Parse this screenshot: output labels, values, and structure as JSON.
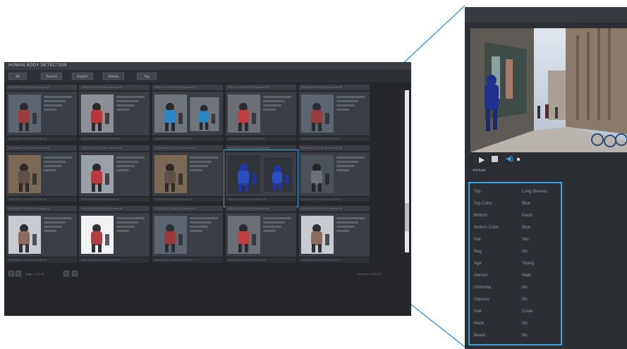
{
  "main_window": {
    "title": "HUMAN BODY DETECTION",
    "toolbar": [
      "All",
      "Search",
      "Export",
      "Delete",
      "Tag"
    ]
  },
  "cells": [
    {
      "head": "2018-08-02 15:32:18 Camera 01",
      "foot": "2018-08-02 15:32:18 00:00:05",
      "style": "street-crowd"
    },
    {
      "head": "2018-08-02 15:32:40 Camera 01",
      "foot": "2018-08-02 15:32:40 00:00:06",
      "style": "street-red"
    },
    {
      "head": "2018-08-02 15:33:02 Camera 02",
      "foot": "2018-08-02 15:33:02 00:00:04",
      "style": "street-blue",
      "double": true
    },
    {
      "head": "2018-08-02 15:33:27 Camera 02",
      "foot": "2018-08-02 15:33:27 00:00:07",
      "style": "street-bus"
    },
    {
      "head": "2018-08-02 15:33:51 Camera 03",
      "foot": "2018-08-02 15:33:51 00:00:05",
      "style": "street-crowd"
    },
    {
      "head": "2018-08-02 15:34:10 Camera 03",
      "foot": "2018-08-02 15:34:10 00:00:03",
      "style": "wall-brown"
    },
    {
      "head": "2018-08-02 15:34:32 Camera 03",
      "foot": "2018-08-02 15:34:32 00:00:06",
      "style": "street-flag"
    },
    {
      "head": "2018-08-02 15:34:55 Camera 04",
      "foot": "2018-08-02 15:34:55 00:00:05",
      "style": "wall-brown"
    },
    {
      "head": "2018-08-02 15:35:13 Camera 04",
      "foot": "2018-08-02 15:35:13 00:00:04",
      "style": "blue-person",
      "double": true,
      "selected": true
    },
    {
      "head": "2018-08-02 15:35:38 Camera 04",
      "foot": "2018-08-02 15:35:38 00:00:06",
      "style": "street-dark"
    },
    {
      "head": "2018-08-02 15:36:01 Camera 05",
      "foot": "2018-08-02 15:36:01 00:00:05",
      "style": "snow"
    },
    {
      "head": "2018-08-02 15:36:24 Camera 05",
      "foot": "2018-08-02 15:36:24 00:00:03",
      "style": "white"
    },
    {
      "head": "2018-08-02 15:36:47 Camera 05",
      "foot": "2018-08-02 15:36:47 00:00:06",
      "style": "street-crowd"
    },
    {
      "head": "2018-08-02 15:37:09 Camera 06",
      "foot": "2018-08-02 15:37:09 00:00:05",
      "style": "street-bus"
    },
    {
      "head": "2018-08-02 15:37:30 Camera 06",
      "foot": "2018-08-02 15:37:30 00:00:04",
      "style": "snow"
    }
  ],
  "pager": {
    "text": "Page 1 / 16  Go",
    "right": "15 results   Total 240"
  },
  "detail": {
    "attributes_label": "Attribute",
    "attributes": [
      {
        "key": "Top",
        "value": "Long Sleeves"
      },
      {
        "key": "Top Color",
        "value": "Blue"
      },
      {
        "key": "Bottom",
        "value": "Pants"
      },
      {
        "key": "Bottom Color",
        "value": "Blue"
      },
      {
        "key": "Hat",
        "value": "Yes"
      },
      {
        "key": "Bag",
        "value": "No"
      },
      {
        "key": "Age",
        "value": "Young"
      },
      {
        "key": "Gender",
        "value": "Male"
      },
      {
        "key": "Umbrella",
        "value": "No"
      },
      {
        "key": "Glasses",
        "value": "No"
      },
      {
        "key": "Hair",
        "value": "Cover"
      },
      {
        "key": "Mask",
        "value": "No"
      },
      {
        "key": "Beard",
        "value": "No"
      }
    ]
  },
  "colors": {
    "accent": "#3fa0dc",
    "panel": "#25272b",
    "card": "#3b3f45"
  }
}
